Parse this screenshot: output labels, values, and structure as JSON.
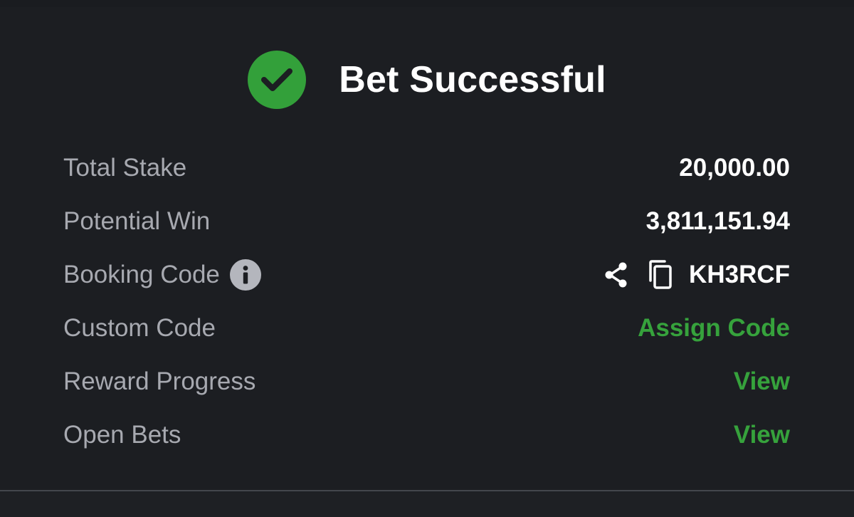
{
  "header": {
    "title": "Bet Successful",
    "icon": "check-circle-icon",
    "icon_color": "#33a03a"
  },
  "rows": [
    {
      "label": "Total Stake",
      "value": "20,000.00"
    },
    {
      "label": "Potential Win",
      "value": "3,811,151.94"
    },
    {
      "label": "Booking Code",
      "value": "KH3RCF",
      "label_icon": "info-icon",
      "value_icons": [
        "share-icon",
        "copy-icon"
      ]
    },
    {
      "label": "Custom Code",
      "value": "Assign Code",
      "value_color": "#36a23c"
    },
    {
      "label": "Reward Progress",
      "value": "View",
      "value_color": "#36a23c"
    },
    {
      "label": "Open Bets",
      "value": "View",
      "value_color": "#36a23c"
    }
  ],
  "colors": {
    "background": "#1c1e22",
    "label": "#a7a9b0",
    "value": "#ffffff",
    "accent": "#36a23c"
  }
}
